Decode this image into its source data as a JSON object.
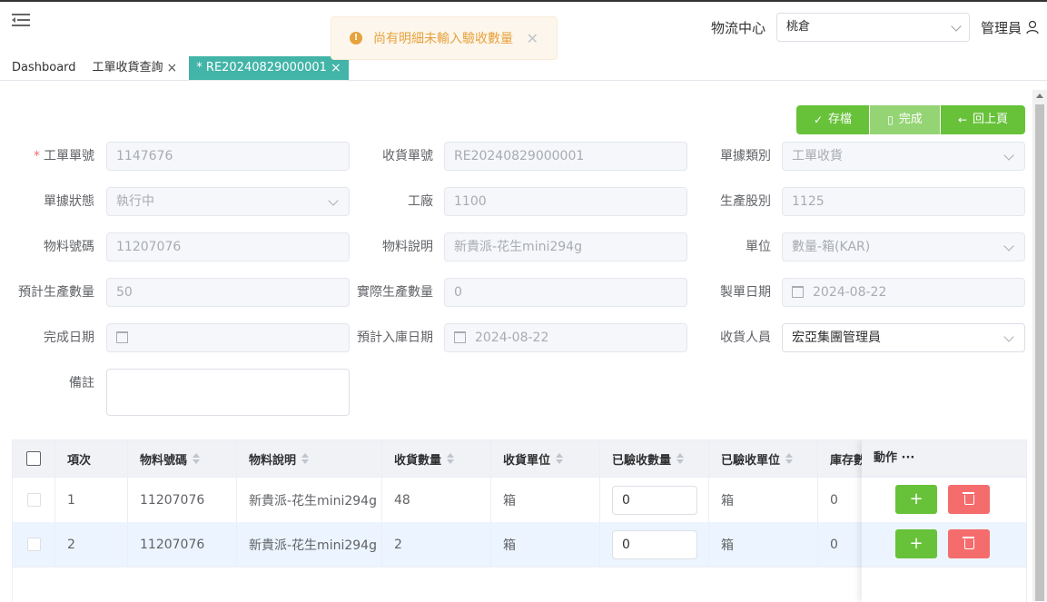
{
  "header": {
    "logistics_label": "物流中心",
    "logistics_value": "桃倉",
    "user_name": "管理員"
  },
  "toast": {
    "message": "尚有明細未輸入驗收數量"
  },
  "tabs": [
    {
      "label": "Dashboard"
    },
    {
      "label": "工單收貨查詢"
    },
    {
      "label": "* RE20240829000001"
    }
  ],
  "actions": {
    "save": "存檔",
    "complete": "完成",
    "back": "回上頁"
  },
  "form": {
    "work_order_no": {
      "label": "工單單號",
      "value": "1147676"
    },
    "receipt_no": {
      "label": "收貨單號",
      "value": "RE20240829000001"
    },
    "doc_type": {
      "label": "單據類別",
      "value": "工單收貨"
    },
    "doc_status": {
      "label": "單據狀態",
      "value": "執行中"
    },
    "factory": {
      "label": "工廠",
      "value": "1100"
    },
    "production_section": {
      "label": "生產股別",
      "value": "1125"
    },
    "material_no": {
      "label": "物料號碼",
      "value": "11207076"
    },
    "material_desc": {
      "label": "物料說明",
      "value": "新貴派-花生mini294g"
    },
    "unit": {
      "label": "單位",
      "value": "數量-箱(KAR)"
    },
    "planned_qty": {
      "label": "預計生產數量",
      "value": "50"
    },
    "actual_qty": {
      "label": "實際生產數量",
      "value": "0"
    },
    "issue_date": {
      "label": "製單日期",
      "value": "2024-08-22"
    },
    "complete_date": {
      "label": "完成日期",
      "value": ""
    },
    "expected_stock_date": {
      "label": "預計入庫日期",
      "value": "2024-08-22"
    },
    "receiver": {
      "label": "收貨人員",
      "value": "宏亞集團管理員"
    },
    "remark": {
      "label": "備註",
      "value": ""
    }
  },
  "table": {
    "columns": [
      "項次",
      "物料號碼",
      "物料說明",
      "收貨數量",
      "收貨單位",
      "已驗收數量",
      "已驗收單位",
      "庫存數",
      "動作"
    ],
    "action_more": "···",
    "rows": [
      {
        "item": "1",
        "material_no": "11207076",
        "desc": "新貴派-花生mini294g",
        "qty": "48",
        "unit": "箱",
        "accepted_qty": "0",
        "accepted_unit": "箱",
        "stock": "0"
      },
      {
        "item": "2",
        "material_no": "11207076",
        "desc": "新貴派-花生mini294g",
        "qty": "2",
        "unit": "箱",
        "accepted_qty": "0",
        "accepted_unit": "箱",
        "stock": "0"
      }
    ]
  }
}
